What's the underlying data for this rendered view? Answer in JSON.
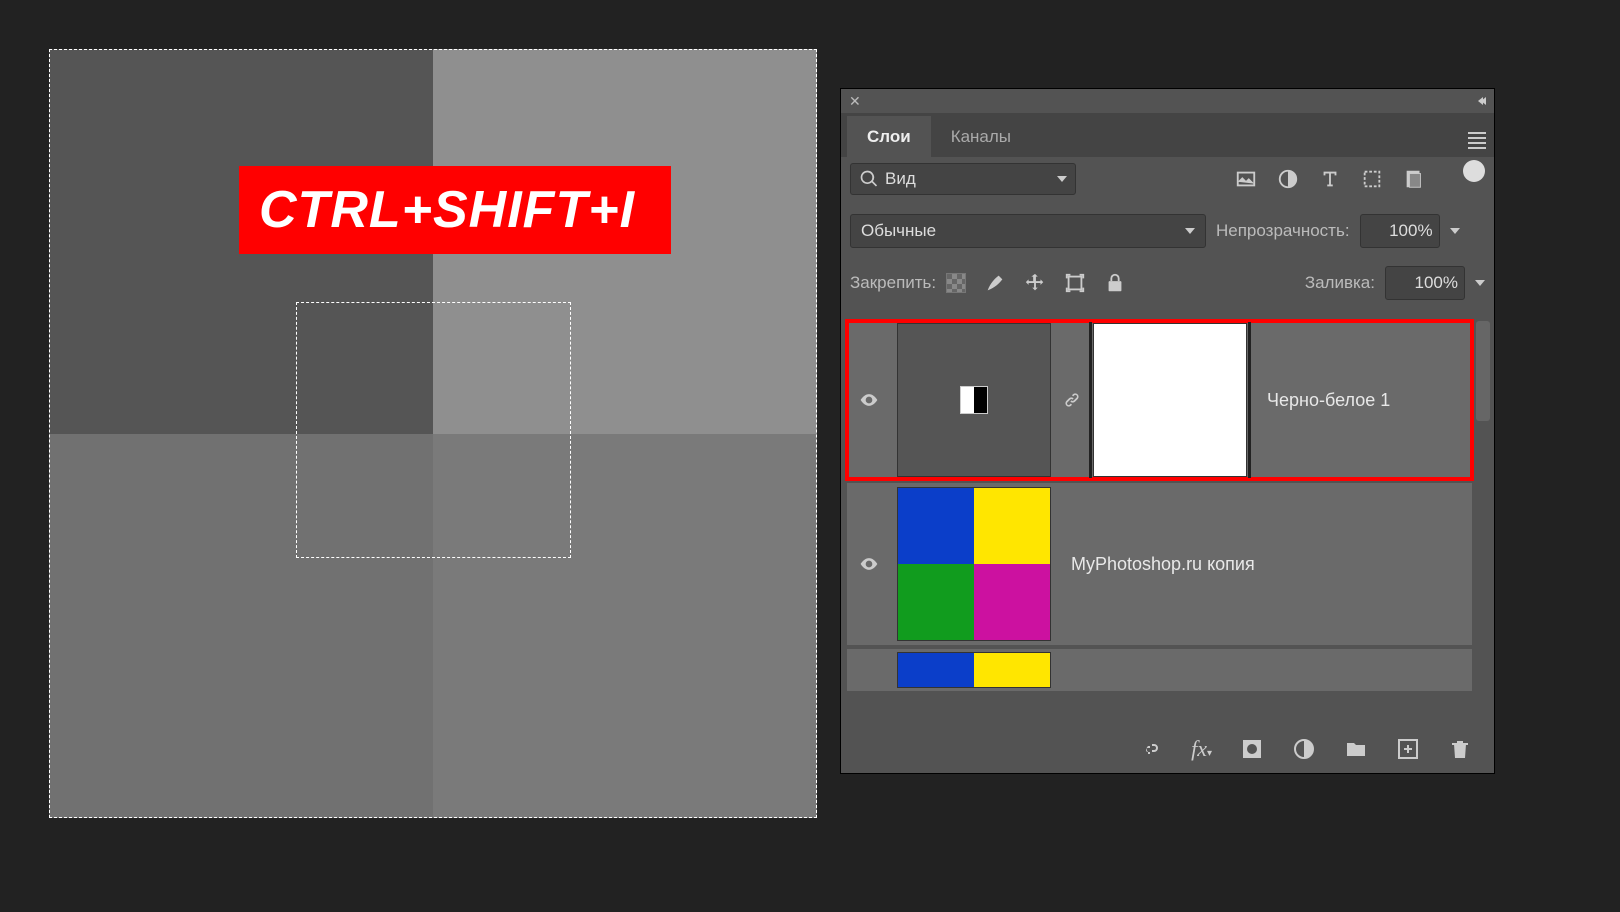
{
  "canvas": {
    "overlay_text": "CTRL+SHIFT+I"
  },
  "panel": {
    "tabs": [
      "Слои",
      "Каналы"
    ],
    "active_tab": 0,
    "search": {
      "label": "Вид"
    },
    "blend_mode": "Обычные",
    "opacity": {
      "label": "Непрозрачность:",
      "value": "100%"
    },
    "lock": {
      "label": "Закрепить:"
    },
    "fill": {
      "label": "Заливка:",
      "value": "100%"
    },
    "layers": [
      {
        "name": "Черно-белое 1",
        "type": "adjustment_bw",
        "visible": true,
        "highlighted": true
      },
      {
        "name": "MyPhotoshop.ru копия",
        "type": "raster_quad",
        "visible": true,
        "highlighted": false
      },
      {
        "name": "",
        "type": "raster_quad_partial",
        "visible": false,
        "highlighted": false
      }
    ]
  }
}
